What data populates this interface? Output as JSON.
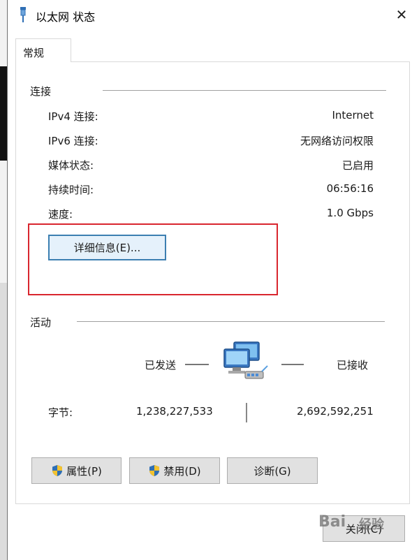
{
  "window": {
    "title": "以太网 状态",
    "close_glyph": "✕"
  },
  "tab": {
    "label": "常规"
  },
  "connection": {
    "group_title": "连接",
    "rows": [
      {
        "label": "IPv4 连接:",
        "value": "Internet"
      },
      {
        "label": "IPv6 连接:",
        "value": "无网络访问权限"
      },
      {
        "label": "媒体状态:",
        "value": "已启用"
      },
      {
        "label": "持续时间:",
        "value": "06:56:16"
      },
      {
        "label": "速度:",
        "value": "1.0 Gbps"
      }
    ],
    "details_button": "详细信息(E)..."
  },
  "activity": {
    "group_title": "活动",
    "sent_label": "已发送",
    "received_label": "已接收",
    "bytes_label": "字节:",
    "bytes_sent": "1,238,227,533",
    "bytes_received": "2,692,592,251"
  },
  "buttons": {
    "properties": "属性(P)",
    "disable": "禁用(D)",
    "diagnose": "诊断(G)",
    "close": "关闭(C)"
  },
  "icons": {
    "title_icon": "ethernet-plug-icon",
    "network": "network-computers-icon",
    "shield": "uac-shield-icon"
  },
  "colors": {
    "highlight_box": "#d9262e",
    "focus_border": "#3c7fb1"
  },
  "watermark": {
    "text": "Bai",
    "subtext": "经验"
  }
}
